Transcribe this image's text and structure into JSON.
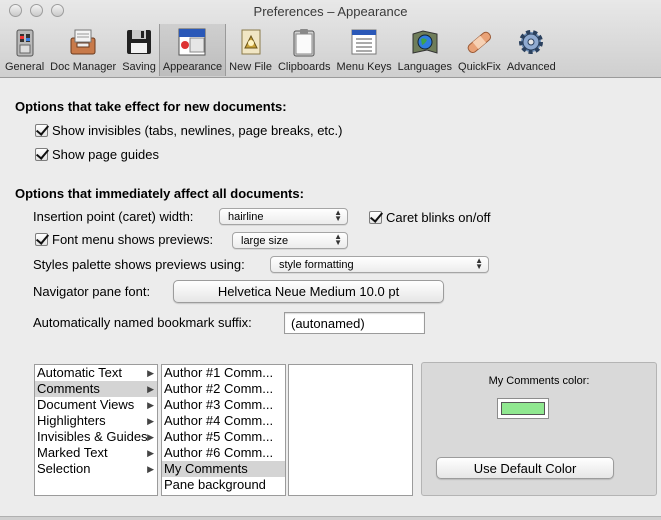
{
  "window": {
    "title": "Preferences – Appearance"
  },
  "toolbar": {
    "items": [
      {
        "label": "General",
        "icon": "general-icon"
      },
      {
        "label": "Doc Manager",
        "icon": "doc-manager-icon"
      },
      {
        "label": "Saving",
        "icon": "floppy-disk-icon"
      },
      {
        "label": "Appearance",
        "icon": "appearance-icon",
        "selected": true
      },
      {
        "label": "New File",
        "icon": "new-file-icon"
      },
      {
        "label": "Clipboards",
        "icon": "clipboard-icon"
      },
      {
        "label": "Menu Keys",
        "icon": "menu-keys-icon"
      },
      {
        "label": "Languages",
        "icon": "globe-icon"
      },
      {
        "label": "QuickFix",
        "icon": "bandage-icon"
      },
      {
        "label": "Advanced",
        "icon": "gear-icon"
      }
    ]
  },
  "new_docs": {
    "heading": "Options that take effect for new documents:",
    "show_invisibles": {
      "label": "Show invisibles (tabs, newlines, page breaks, etc.)",
      "checked": true
    },
    "show_page_guides": {
      "label": "Show page guides",
      "checked": true
    }
  },
  "all_docs": {
    "heading": "Options that immediately affect all documents:",
    "caret_width": {
      "label": "Insertion point (caret) width:",
      "value": "hairline"
    },
    "caret_blinks": {
      "label": "Caret blinks on/off",
      "checked": true
    },
    "font_menu": {
      "label": "Font menu shows previews:",
      "checked": true,
      "value": "large size"
    },
    "styles_palette": {
      "label": "Styles palette shows previews using:",
      "value": "style formatting"
    },
    "navigator_font": {
      "label": "Navigator pane font:",
      "value": "Helvetica Neue Medium 10.0 pt"
    },
    "bookmark_suffix": {
      "label": "Automatically named bookmark suffix:",
      "value": "(autonamed)"
    }
  },
  "categories": [
    {
      "label": "Automatic Text"
    },
    {
      "label": "Comments",
      "selected": true
    },
    {
      "label": "Document Views"
    },
    {
      "label": "Highlighters"
    },
    {
      "label": "Invisibles & Guides"
    },
    {
      "label": "Marked Text"
    },
    {
      "label": "Selection"
    }
  ],
  "subitems": [
    {
      "label": "Author #1 Comm..."
    },
    {
      "label": "Author #2 Comm..."
    },
    {
      "label": "Author #3 Comm..."
    },
    {
      "label": "Author #4 Comm..."
    },
    {
      "label": "Author #5 Comm..."
    },
    {
      "label": "Author #6 Comm..."
    },
    {
      "label": "My Comments",
      "selected": true
    },
    {
      "label": "Pane background"
    }
  ],
  "color_panel": {
    "label": "My Comments color:",
    "color": "#90e890",
    "default_button": "Use Default Color"
  }
}
